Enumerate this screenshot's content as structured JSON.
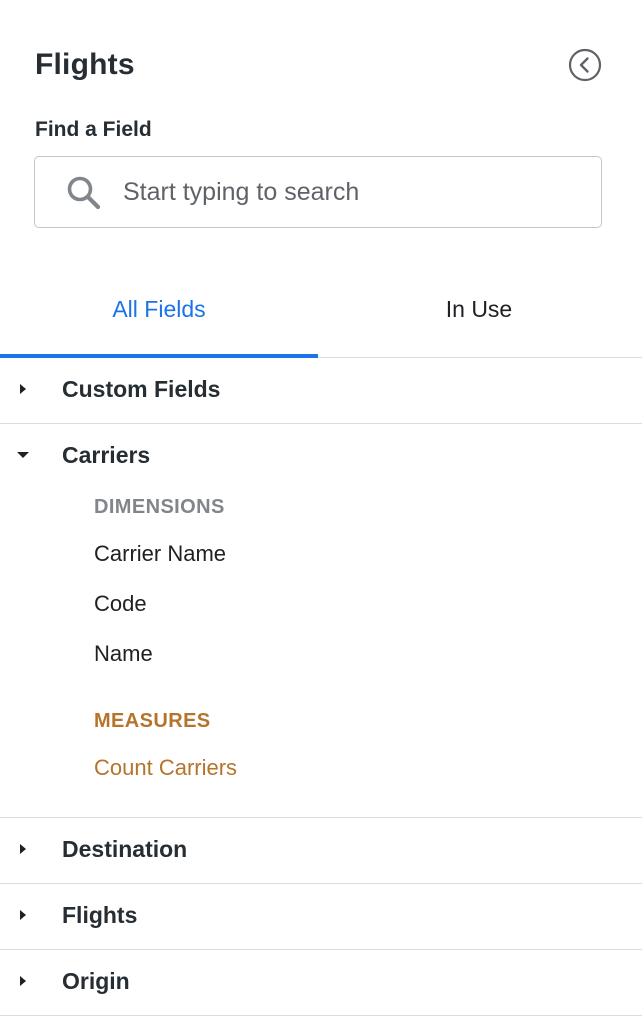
{
  "header": {
    "title": "Flights",
    "collapse_icon": "chevron-left-circle-icon"
  },
  "search": {
    "label": "Find a Field",
    "placeholder": "Start typing to search",
    "value": ""
  },
  "tabs": [
    {
      "label": "All Fields",
      "active": true
    },
    {
      "label": "In Use",
      "active": false
    }
  ],
  "groups": [
    {
      "label": "Custom Fields",
      "expanded": false
    },
    {
      "label": "Carriers",
      "expanded": true,
      "dimensions_label": "DIMENSIONS",
      "dimensions": [
        "Carrier Name",
        "Code",
        "Name"
      ],
      "measures_label": "MEASURES",
      "measures": [
        "Count Carriers"
      ]
    },
    {
      "label": "Destination",
      "expanded": false
    },
    {
      "label": "Flights",
      "expanded": false
    },
    {
      "label": "Origin",
      "expanded": false
    }
  ],
  "colors": {
    "accent": "#1a73e8",
    "measure": "#b5742c",
    "dimension_label": "#80868b",
    "divider": "#dadce0"
  }
}
